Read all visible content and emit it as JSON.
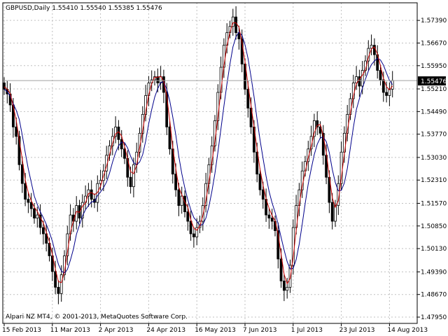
{
  "window": {
    "symbol_line": "GBPUSD,Daily  1.55410 1.55540 1.55385 1.55476",
    "copyright": "Alpari NZ MT4, © 2001-2013, MetaQuotes Software Corp.",
    "current_price_label": "1.55476"
  },
  "colors": {
    "background": "#ffffff",
    "grid": "#c0c0c0",
    "bar_up": "#000000",
    "bar_down": "#000000",
    "ma_fast": "#00008b",
    "ma_slow": "#cc0000",
    "price_line": "#a0a0a0"
  },
  "chart_data": {
    "type": "candlestick",
    "title": "GBPUSD,Daily",
    "ohlc_header": {
      "open": 1.5541,
      "high": 1.5554,
      "low": 1.55385,
      "close": 1.55476
    },
    "current_price": 1.55476,
    "ylim": [
      1.4775,
      1.5795
    ],
    "y_ticks": [
      "1.57390",
      "1.56670",
      "1.55950",
      "1.55210",
      "1.54490",
      "1.53770",
      "1.53030",
      "1.52310",
      "1.51570",
      "1.50850",
      "1.50130",
      "1.49390",
      "1.48670",
      "1.47950"
    ],
    "y_tick_values": [
      1.5739,
      1.5667,
      1.5595,
      1.5521,
      1.5449,
      1.5377,
      1.5303,
      1.5231,
      1.5157,
      1.5085,
      1.5013,
      1.4939,
      1.4867,
      1.4795
    ],
    "x_ticks": [
      "15 Feb 2013",
      "11 Mar 2013",
      "2 Apr 2013",
      "24 Apr 2013",
      "16 May 2013",
      "7 Jun 2013",
      "1 Jul 2013",
      "23 Jul 2013",
      "14 Aug 2013"
    ],
    "x_tick_bar_index": [
      0,
      16,
      32,
      48,
      64,
      80,
      96,
      112,
      128
    ],
    "grid": true,
    "closes": [
      1.552,
      1.5505,
      1.547,
      1.54,
      1.537,
      1.528,
      1.522,
      1.517,
      1.516,
      1.514,
      1.511,
      1.512,
      1.508,
      1.506,
      1.503,
      1.499,
      1.494,
      1.489,
      1.487,
      1.493,
      1.499,
      1.506,
      1.512,
      1.51,
      1.515,
      1.511,
      1.516,
      1.518,
      1.52,
      1.517,
      1.516,
      1.522,
      1.523,
      1.526,
      1.531,
      1.534,
      1.537,
      1.54,
      1.536,
      1.533,
      1.53,
      1.524,
      1.521,
      1.528,
      1.532,
      1.538,
      1.544,
      1.55,
      1.554,
      1.555,
      1.556,
      1.554,
      1.556,
      1.551,
      1.54,
      1.533,
      1.525,
      1.52,
      1.515,
      1.518,
      1.513,
      1.51,
      1.506,
      1.505,
      1.508,
      1.51,
      1.515,
      1.522,
      1.528,
      1.534,
      1.542,
      1.551,
      1.559,
      1.566,
      1.57,
      1.572,
      1.575,
      1.57,
      1.568,
      1.56,
      1.552,
      1.546,
      1.54,
      1.532,
      1.525,
      1.52,
      1.517,
      1.512,
      1.511,
      1.51,
      1.507,
      1.498,
      1.491,
      1.488,
      1.489,
      1.496,
      1.508,
      1.515,
      1.52,
      1.526,
      1.529,
      1.533,
      1.537,
      1.542,
      1.54,
      1.538,
      1.531,
      1.524,
      1.516,
      1.51,
      1.515,
      1.522,
      1.532,
      1.538,
      1.544,
      1.549,
      1.554,
      1.556,
      1.553,
      1.558,
      1.561,
      1.565,
      1.566,
      1.563,
      1.558,
      1.555,
      1.551,
      1.55,
      1.552,
      1.5548
    ],
    "series": [
      {
        "name": "",
        "kind": "ma_fast"
      },
      {
        "name": "",
        "kind": "ma_slow"
      }
    ]
  }
}
